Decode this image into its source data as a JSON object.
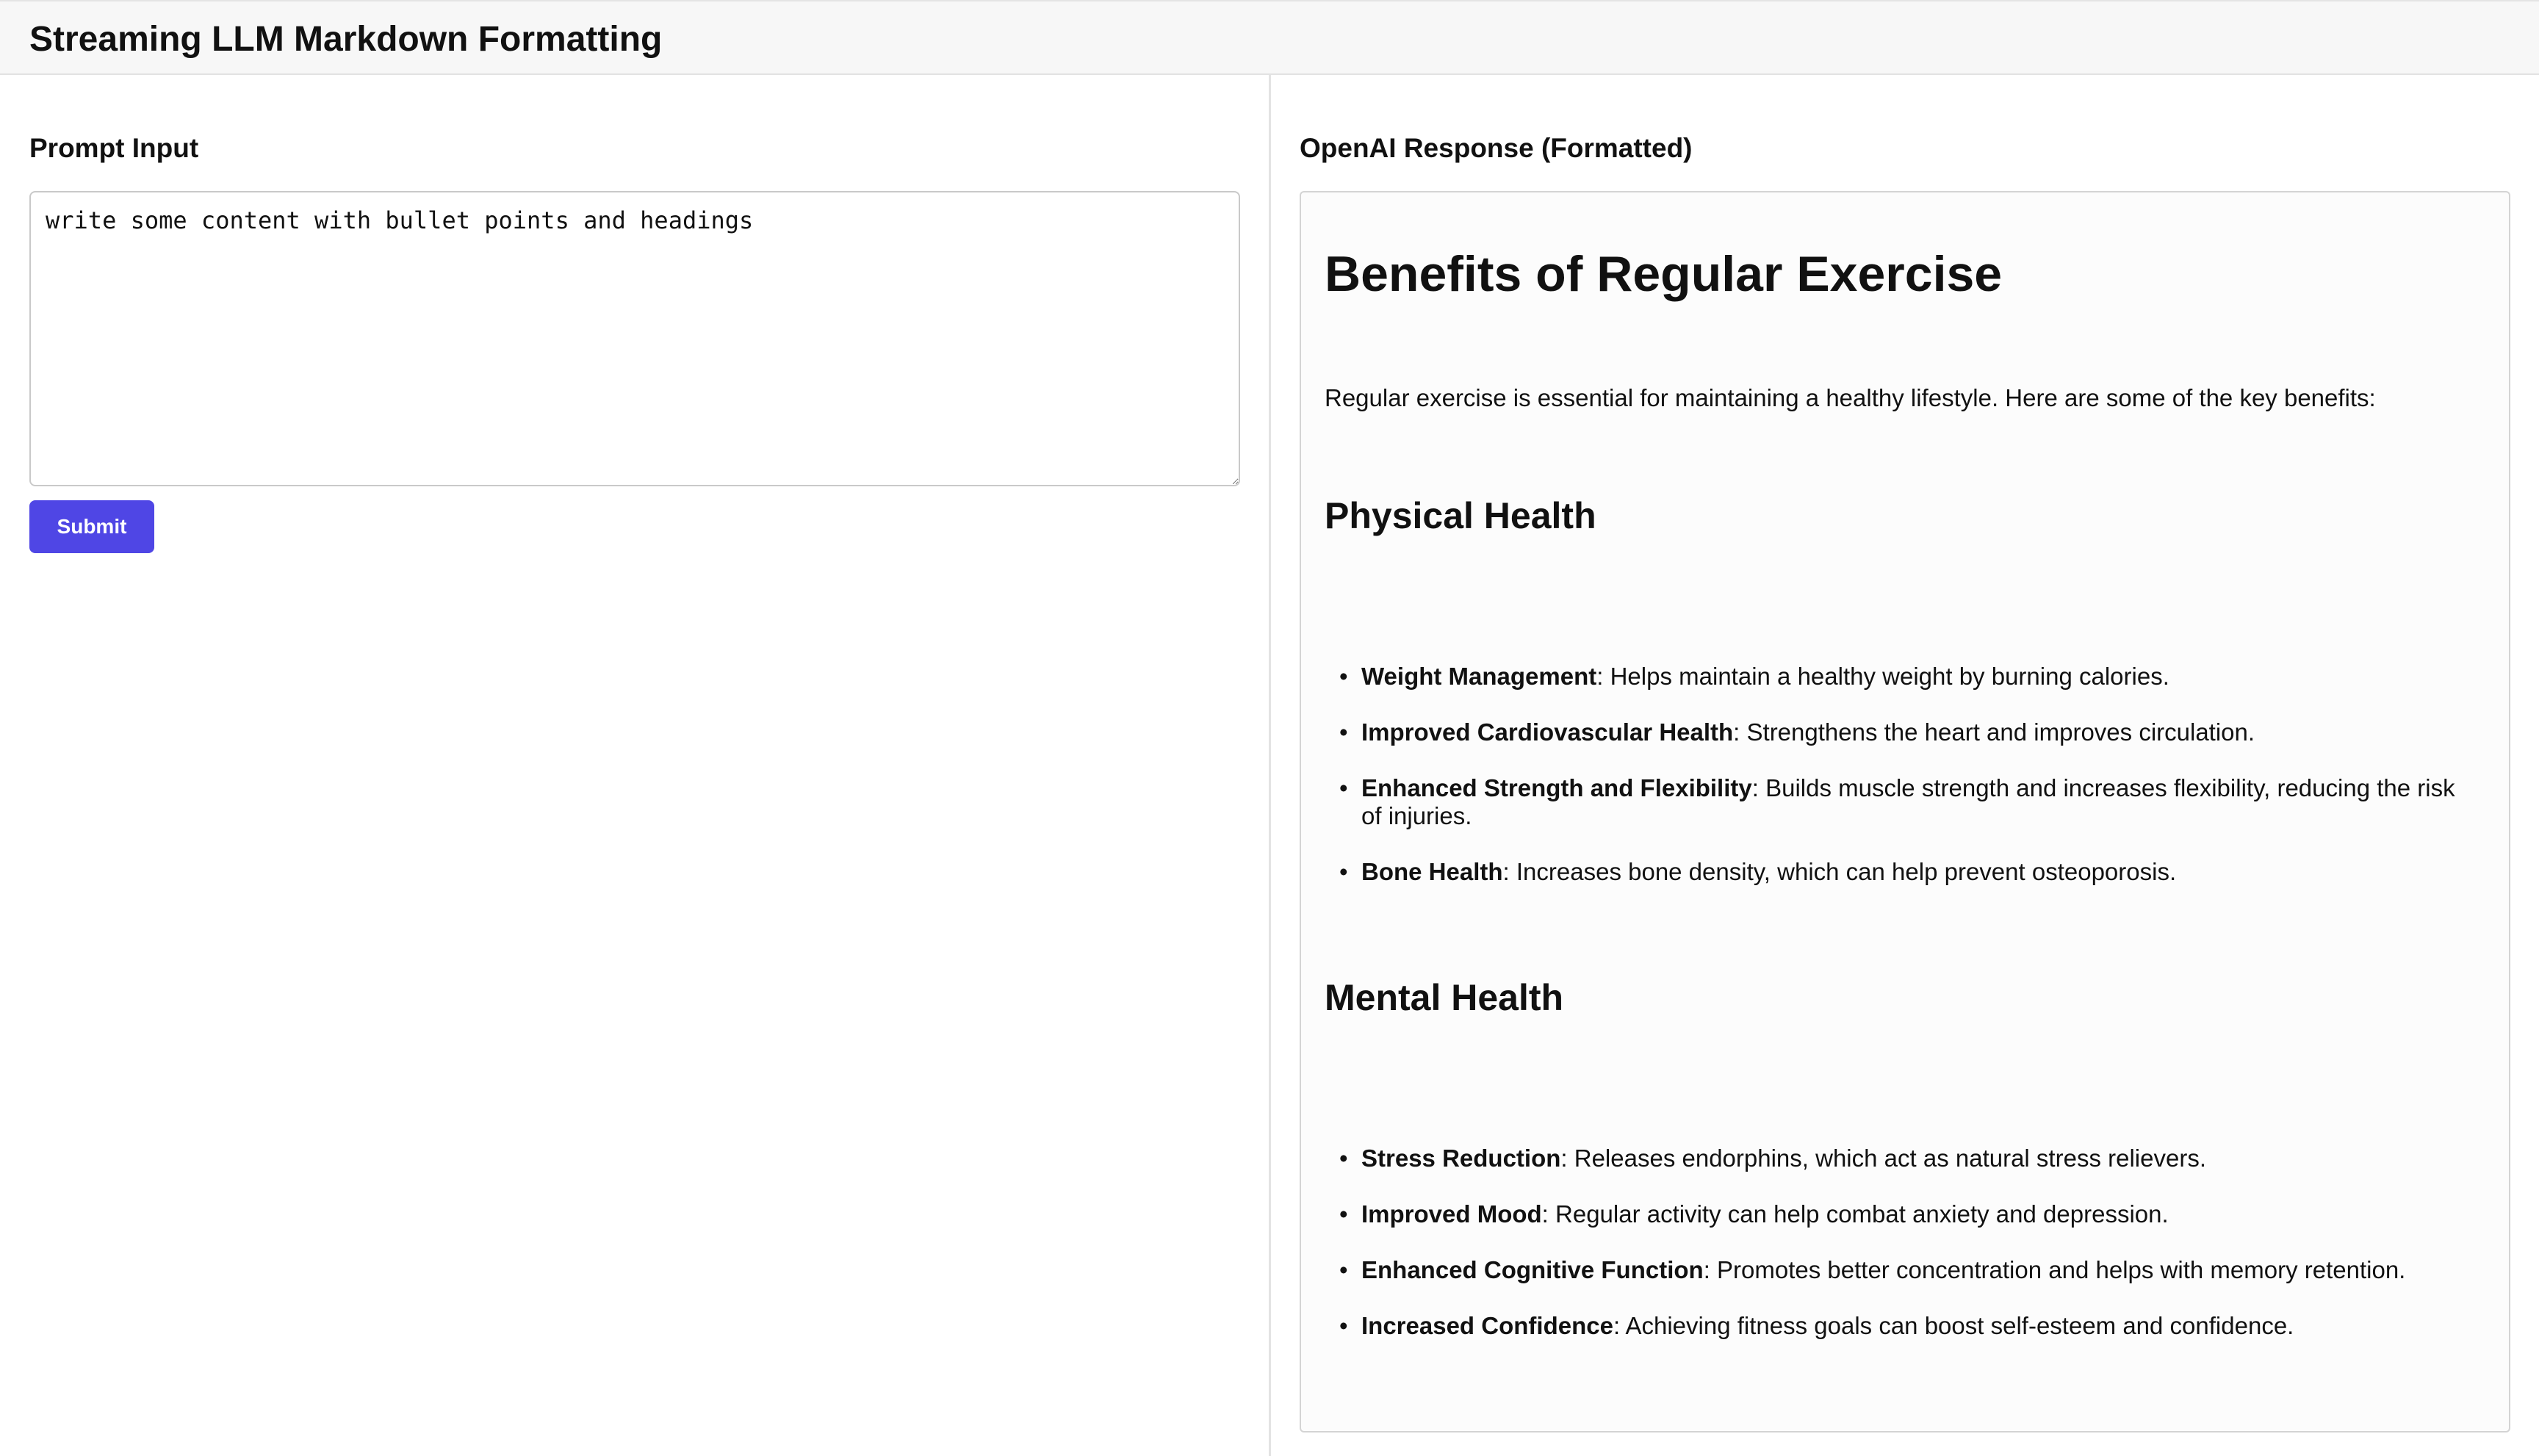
{
  "header": {
    "title": "Streaming LLM Markdown Formatting"
  },
  "prompt": {
    "section_title": "Prompt Input",
    "value": "write some content with bullet points and headings",
    "submit_label": "Submit"
  },
  "response": {
    "section_title": "OpenAI Response (Formatted)",
    "heading": "Benefits of Regular Exercise",
    "intro": "Regular exercise is essential for maintaining a healthy lifestyle. Here are some of the key benefits:",
    "sections": [
      {
        "heading": "Physical Health",
        "items": [
          {
            "term": "Weight Management",
            "text": ": Helps maintain a healthy weight by burning calories."
          },
          {
            "term": "Improved Cardiovascular Health",
            "text": ": Strengthens the heart and improves circulation."
          },
          {
            "term": "Enhanced Strength and Flexibility",
            "text": ": Builds muscle strength and increases flexibility, reducing the risk of injuries."
          },
          {
            "term": "Bone Health",
            "text": ": Increases bone density, which can help prevent osteoporosis."
          }
        ]
      },
      {
        "heading": "Mental Health",
        "items": [
          {
            "term": "Stress Reduction",
            "text": ": Releases endorphins, which act as natural stress relievers."
          },
          {
            "term": "Improved Mood",
            "text": ": Regular activity can help combat anxiety and depression."
          },
          {
            "term": "Enhanced Cognitive Function",
            "text": ": Promotes better concentration and helps with memory retention."
          },
          {
            "term": "Increased Confidence",
            "text": ": Achieving fitness goals can boost self-esteem and confidence."
          }
        ]
      }
    ]
  },
  "colors": {
    "accent": "#4f46e5",
    "header_bg": "#f7f7f7",
    "panel_bg": "#fcfcfc"
  }
}
